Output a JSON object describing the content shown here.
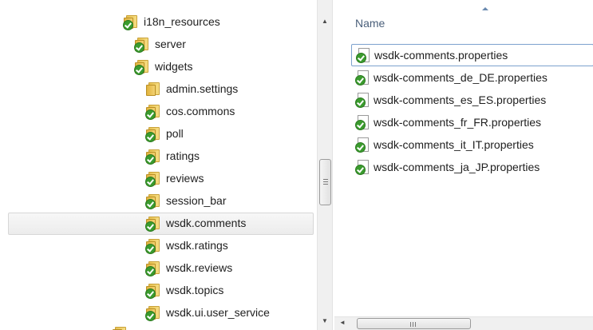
{
  "tree": {
    "items": [
      {
        "label": "i18n_resources",
        "type": "folder-checked"
      },
      {
        "label": "server",
        "type": "folder-checked"
      },
      {
        "label": "widgets",
        "type": "folder-checked"
      },
      {
        "label": "admin.settings",
        "type": "folder"
      },
      {
        "label": "cos.commons",
        "type": "folder-checked"
      },
      {
        "label": "poll",
        "type": "folder-checked"
      },
      {
        "label": "ratings",
        "type": "folder-checked"
      },
      {
        "label": "reviews",
        "type": "folder-checked"
      },
      {
        "label": "session_bar",
        "type": "folder-checked"
      },
      {
        "label": "wsdk.comments",
        "type": "folder-checked",
        "selected": true
      },
      {
        "label": "wsdk.ratings",
        "type": "folder-checked"
      },
      {
        "label": "wsdk.reviews",
        "type": "folder-checked"
      },
      {
        "label": "wsdk.topics",
        "type": "folder-checked"
      },
      {
        "label": "wsdk.ui.user_service",
        "type": "folder-checked"
      }
    ]
  },
  "file_list": {
    "column_header": "Name",
    "files": [
      {
        "name": "wsdk-comments.properties",
        "focused": true
      },
      {
        "name": "wsdk-comments_de_DE.properties"
      },
      {
        "name": "wsdk-comments_es_ES.properties"
      },
      {
        "name": "wsdk-comments_fr_FR.properties"
      },
      {
        "name": "wsdk-comments_it_IT.properties"
      },
      {
        "name": "wsdk-comments_ja_JP.properties"
      }
    ]
  },
  "scrollbars": {
    "up_arrow": "▲",
    "down_arrow": "▼",
    "left_arrow": "◄"
  },
  "colors": {
    "check_green": "#3b9b2e",
    "folder_yellow": "#f3d273",
    "header_text": "#4a5f7a",
    "focus_border": "#7da2ce"
  }
}
